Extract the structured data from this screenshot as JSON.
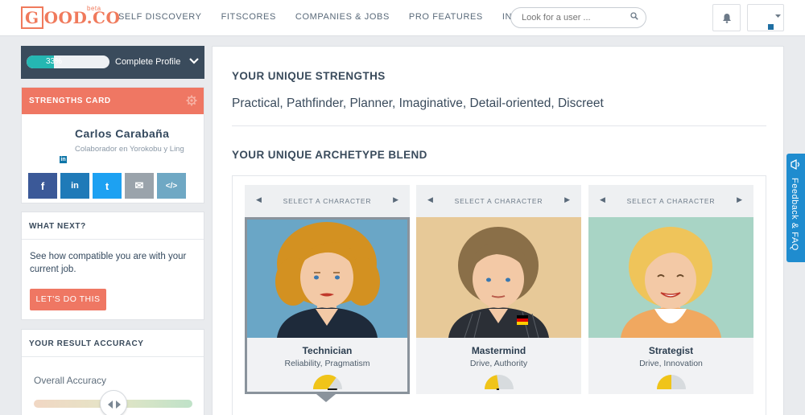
{
  "header": {
    "logo": "GOOD.CO",
    "logo_badge": "beta",
    "nav": [
      "SELF DISCOVERY",
      "FITSCORES",
      "COMPANIES & JOBS",
      "PRO FEATURES",
      "INSIGHTS"
    ],
    "search_placeholder": "Look for a user ...",
    "icons": [
      "search-icon",
      "bell-icon",
      "linkedin-icon",
      "caret-down-icon"
    ]
  },
  "sidebar": {
    "profile": {
      "progress_percent": 33,
      "progress_label": "33%",
      "label": "Complete Profile"
    },
    "strengths_card": {
      "title": "STRENGTHS CARD",
      "name": "Carlos Carabaña",
      "role": "Colaborador en Yorokobu y Ling",
      "share_buttons": [
        {
          "icon": "facebook-icon",
          "glyph": "f",
          "color": "#3b5998"
        },
        {
          "icon": "linkedin-icon",
          "glyph": "in",
          "color": "#1f7ab8"
        },
        {
          "icon": "twitter-icon",
          "glyph": "t",
          "color": "#1da1f2"
        },
        {
          "icon": "email-icon",
          "glyph": "✉",
          "color": "#9aa3ab"
        },
        {
          "icon": "embed-icon",
          "glyph": "</>",
          "color": "#6fa8c4"
        }
      ]
    },
    "what_next": {
      "title": "WHAT NEXT?",
      "text": "See how compatible you are with your current job.",
      "button": "LET'S DO THIS"
    },
    "accuracy": {
      "title": "YOUR RESULT ACCURACY",
      "label": "Overall Accuracy"
    }
  },
  "main": {
    "strengths_heading": "YOUR UNIQUE STRENGTHS",
    "strengths": "Practical, Pathfinder, Planner, Imaginative, Detail-oriented, Discreet",
    "blend_heading": "YOUR UNIQUE ARCHETYPE BLEND",
    "characters": [
      {
        "select_label": "SELECT A CHARACTER",
        "name": "Technician",
        "traits": "Reliability, Pragmatism",
        "bg": "#6aa6c6",
        "gauge_level": 0.7,
        "selected": true
      },
      {
        "select_label": "SELECT A CHARACTER",
        "name": "Mastermind",
        "traits": "Drive, Authority",
        "bg": "#e7c998",
        "gauge_level": 0.45,
        "selected": false
      },
      {
        "select_label": "SELECT A CHARACTER",
        "name": "Strategist",
        "traits": "Drive, Innovation",
        "bg": "#a8d4c5",
        "gauge_level": 0.5,
        "selected": false
      }
    ]
  },
  "feedback_tab": "Feedback & FAQ"
}
